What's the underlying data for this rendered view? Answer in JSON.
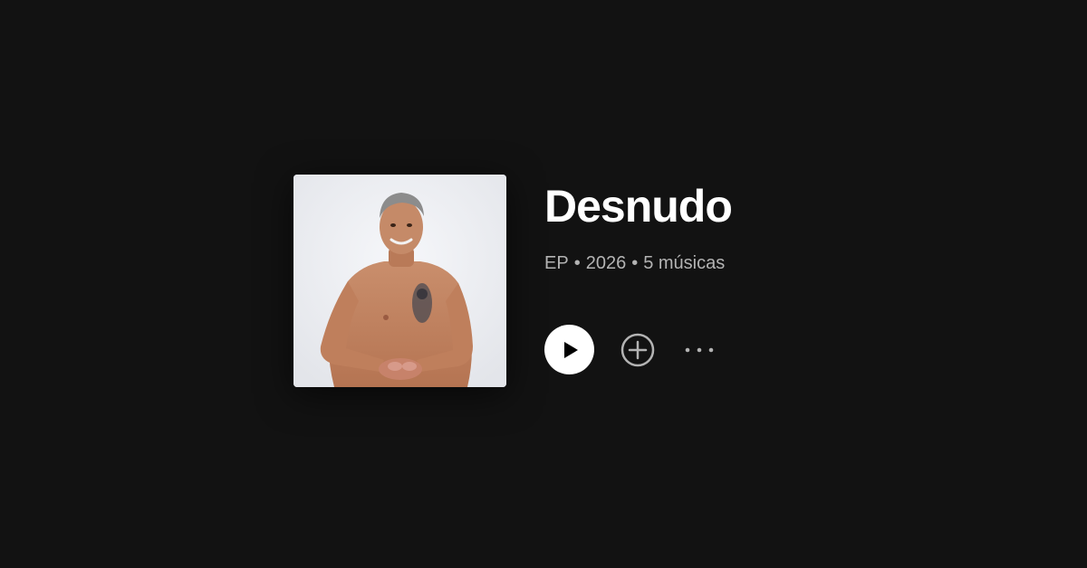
{
  "album": {
    "title": "Desnudo",
    "type": "EP",
    "year": "2026",
    "track_count": "5 músicas",
    "separator": "•"
  },
  "actions": {
    "play": "play-icon",
    "add": "add-circle-icon",
    "more": "more-options-icon"
  },
  "colors": {
    "background": "#121212",
    "title": "#ffffff",
    "meta": "#b3b3b3",
    "play_button": "#ffffff"
  }
}
